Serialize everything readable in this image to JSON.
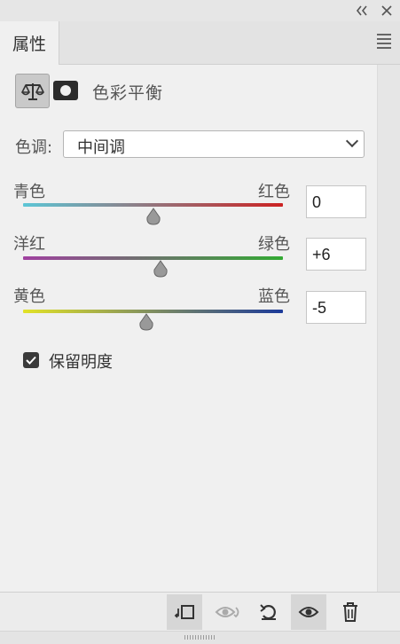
{
  "titlebar": {
    "collapse_icon": "double-chevron-left-icon",
    "close_icon": "close-icon"
  },
  "tabs": [
    {
      "label": "属性"
    }
  ],
  "header": {
    "title": "色彩平衡",
    "adjustment_icon": "balance-scale-icon",
    "mask_icon": "layer-mask-icon"
  },
  "tone": {
    "label": "色调:",
    "value": "中间调"
  },
  "sliders": [
    {
      "left_label": "青色",
      "right_label": "红色",
      "value": "0",
      "position": 0.5,
      "colors": [
        "#5cc6d6",
        "#cc2222"
      ]
    },
    {
      "left_label": "洋红",
      "right_label": "绿色",
      "value": "+6",
      "position": 0.53,
      "colors": [
        "#a040a0",
        "#33aa33"
      ]
    },
    {
      "left_label": "黄色",
      "right_label": "蓝色",
      "value": "-5",
      "position": 0.475,
      "colors": [
        "#e2e227",
        "#1c3a9a"
      ]
    }
  ],
  "preserve_luminosity": {
    "label": "保留明度",
    "checked": true
  },
  "bottom_bar": {
    "buttons": [
      {
        "name": "clip-to-layer-icon"
      },
      {
        "name": "view-previous-state-icon"
      },
      {
        "name": "reset-icon"
      },
      {
        "name": "toggle-visibility-icon"
      },
      {
        "name": "delete-icon"
      }
    ]
  }
}
